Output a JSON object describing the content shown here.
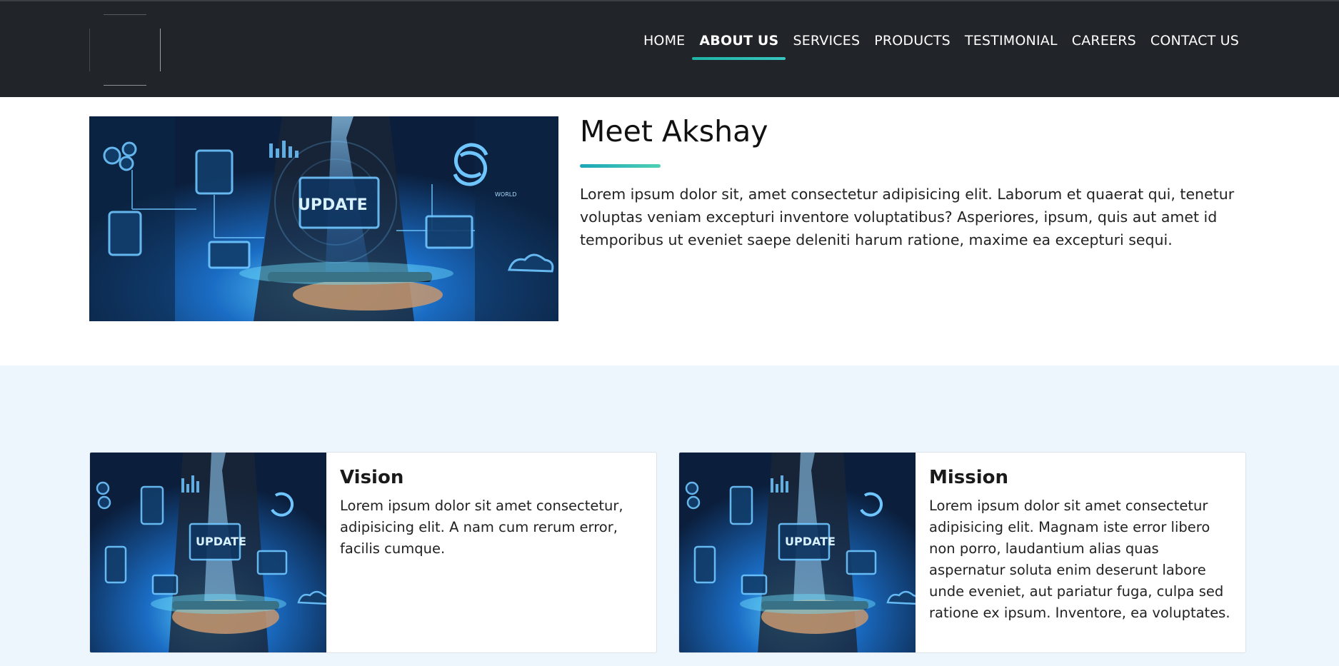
{
  "nav": {
    "items": [
      {
        "label": "HOME",
        "active": false
      },
      {
        "label": "ABOUT US",
        "active": true
      },
      {
        "label": "SERVICES",
        "active": false
      },
      {
        "label": "PRODUCTS",
        "active": false
      },
      {
        "label": "TESTIMONIAL",
        "active": false
      },
      {
        "label": "CAREERS",
        "active": false
      },
      {
        "label": "CONTACT US",
        "active": false
      }
    ]
  },
  "hero": {
    "title": "Meet Akshay",
    "body": "Lorem ipsum dolor sit, amet consectetur adipisicing elit. Laborum et quaerat qui, tenetur voluptas veniam excepturi inventore voluptatibus? Asperiores, ipsum, quis aut amet id temporibus ut eveniet saepe deleniti harum ratione, maxime ea excepturi sequi.",
    "image_text": "UPDATE",
    "image_small_text": "WORLD"
  },
  "cards": {
    "vision": {
      "title": "Vision",
      "body": "Lorem ipsum dolor sit amet consectetur, adipisicing elit. A nam cum rerum error, facilis cumque.",
      "image_text": "UPDATE"
    },
    "mission": {
      "title": "Mission",
      "body": "Lorem ipsum dolor sit amet consectetur adipisicing elit. Magnam iste error libero non porro, laudantium alias quas aspernatur soluta enim deserunt labore unde eveniet, aut pariatur fuga, culpa sed ratione ex ipsum. Inventore, ea voluptates.",
      "image_text": "UPDATE"
    }
  },
  "colors": {
    "navbar_bg": "#212529",
    "accent": "#1fb4a5",
    "section_bg": "#eef6fd"
  }
}
